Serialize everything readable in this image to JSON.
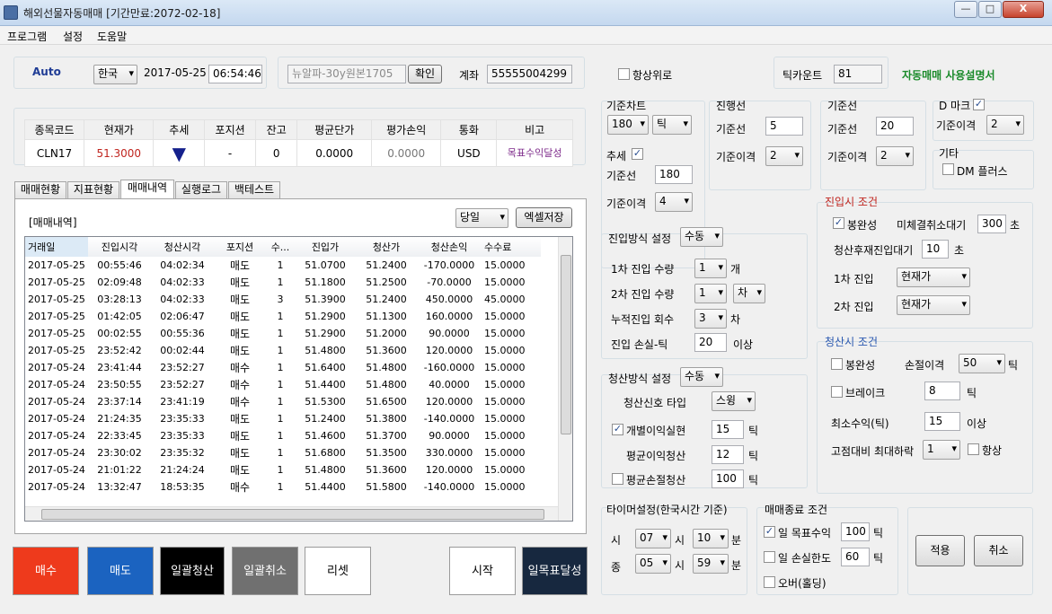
{
  "window": {
    "title": "해외선물자동매매 [기간만료:2072-02-18]",
    "minimize": "—",
    "maximize": "□",
    "close": "X"
  },
  "menu": [
    "프로그램",
    "설정",
    "도움말"
  ],
  "top": {
    "mode": "Auto",
    "country": "한국",
    "date": "2017-05-25",
    "time": "06:54:46",
    "product_placeholder": "뉴알파-30y원본1705",
    "confirm": "확인",
    "account_label": "계좌",
    "account": "55555004299",
    "always_on_top": "항상위로",
    "tick_count_label": "틱카운트",
    "tick_count": "81",
    "manual_link": "자동매매 사용설명서"
  },
  "position": {
    "headers": [
      "종목코드",
      "현재가",
      "추세",
      "포지션",
      "잔고",
      "평균단가",
      "평가손익",
      "통화",
      "비고"
    ],
    "row": {
      "code": "CLN17",
      "price": "51.3000",
      "trend": "▼",
      "position": "-",
      "balance": "0",
      "avg": "0.0000",
      "pnl": "0.0000",
      "currency": "USD",
      "note": "목표수익달성"
    }
  },
  "tabs": [
    "매매현황",
    "지표현황",
    "매매내역",
    "실행로그",
    "백테스트"
  ],
  "history": {
    "title": "[매매내역]",
    "period": "당일",
    "export": "엑셀저장",
    "headers": [
      "거래일",
      "진입시각",
      "청산시각",
      "포지션",
      "수...",
      "진입가",
      "청산가",
      "청산손익",
      "수수료"
    ],
    "rows": [
      [
        "2017-05-25",
        "00:55:46",
        "04:02:34",
        "매도",
        "1",
        "51.0700",
        "51.2400",
        "-170.0000",
        "15.0000"
      ],
      [
        "2017-05-25",
        "02:09:48",
        "04:02:33",
        "매도",
        "1",
        "51.1800",
        "51.2500",
        "-70.0000",
        "15.0000"
      ],
      [
        "2017-05-25",
        "03:28:13",
        "04:02:33",
        "매도",
        "3",
        "51.3900",
        "51.2400",
        "450.0000",
        "45.0000"
      ],
      [
        "2017-05-25",
        "01:42:05",
        "02:06:47",
        "매도",
        "1",
        "51.2900",
        "51.1300",
        "160.0000",
        "15.0000"
      ],
      [
        "2017-05-25",
        "00:02:55",
        "00:55:36",
        "매도",
        "1",
        "51.2900",
        "51.2000",
        "90.0000",
        "15.0000"
      ],
      [
        "2017-05-25",
        "23:52:42",
        "00:02:44",
        "매도",
        "1",
        "51.4800",
        "51.3600",
        "120.0000",
        "15.0000"
      ],
      [
        "2017-05-24",
        "23:41:44",
        "23:52:27",
        "매수",
        "1",
        "51.6400",
        "51.4800",
        "-160.0000",
        "15.0000"
      ],
      [
        "2017-05-24",
        "23:50:55",
        "23:52:27",
        "매수",
        "1",
        "51.4400",
        "51.4800",
        "40.0000",
        "15.0000"
      ],
      [
        "2017-05-24",
        "23:37:14",
        "23:41:19",
        "매수",
        "1",
        "51.5300",
        "51.6500",
        "120.0000",
        "15.0000"
      ],
      [
        "2017-05-24",
        "21:24:35",
        "23:35:33",
        "매도",
        "1",
        "51.2400",
        "51.3800",
        "-140.0000",
        "15.0000"
      ],
      [
        "2017-05-24",
        "22:33:45",
        "23:35:33",
        "매도",
        "1",
        "51.4600",
        "51.3700",
        "90.0000",
        "15.0000"
      ],
      [
        "2017-05-24",
        "23:30:02",
        "23:35:32",
        "매도",
        "1",
        "51.6800",
        "51.3500",
        "330.0000",
        "15.0000"
      ],
      [
        "2017-05-24",
        "21:01:22",
        "21:24:24",
        "매도",
        "1",
        "51.4800",
        "51.3600",
        "120.0000",
        "15.0000"
      ],
      [
        "2017-05-24",
        "13:32:47",
        "18:53:35",
        "매수",
        "1",
        "51.4400",
        "51.5800",
        "-140.0000",
        "15.0000"
      ]
    ]
  },
  "buttons": {
    "buy": "매수",
    "sell": "매도",
    "liquidate_all": "일괄청산",
    "cancel_all": "일괄취소",
    "reset": "리셋",
    "start": "시작",
    "daily_target": "일목표달성"
  },
  "chart_base": {
    "title": "기준차트",
    "value": "180",
    "unit": "틱",
    "trend_label": "추세",
    "trend_base_label": "기준선",
    "trend_base": "180",
    "trend_dev_label": "기준이격",
    "trend_dev": "4"
  },
  "progress_line": {
    "title": "진행선",
    "base_label": "기준선",
    "base": "5",
    "dev_label": "기준이격",
    "dev": "2"
  },
  "base_line": {
    "title": "기준선",
    "base_label": "기준선",
    "base": "20",
    "dev_label": "기준이격",
    "dev": "2"
  },
  "d_mark": {
    "title": "D 마크",
    "dev_label": "기준이격",
    "dev": "2"
  },
  "other": {
    "title": "기타",
    "dm_plus": "DM 플러스"
  },
  "entry_method": {
    "label": "진입방식 설정",
    "value": "수동",
    "q1_label": "1차 진입 수량",
    "q1": "1",
    "q1_unit": "개",
    "q2_label": "2차 진입 수량",
    "q2": "1",
    "q2_unit": "차",
    "cum_label": "누적진입 회수",
    "cum": "3",
    "cum_unit": "차",
    "loss_label": "진입 손실-틱",
    "loss": "20",
    "loss_unit": "이상"
  },
  "exit_method": {
    "label": "청산방식 설정",
    "value": "수동",
    "signal_label": "청산신호 타입",
    "signal": "스윙",
    "indiv_label": "개별이익실현",
    "indiv": "15",
    "avg_profit_label": "평균이익청산",
    "avg_profit": "12",
    "avg_loss_label": "평균손절청산",
    "avg_loss": "100",
    "unit": "틱"
  },
  "entry_cond": {
    "title": "진입시 조건",
    "bongwan": "봉완성",
    "unfilled_label": "미체결취소대기",
    "unfilled": "300",
    "sec": "초",
    "reentry_label": "청산후재진입대기",
    "reentry": "10",
    "e1_label": "1차 진입",
    "e1": "현재가",
    "e2_label": "2차 진입",
    "e2": "현재가"
  },
  "exit_cond": {
    "title": "청산시 조건",
    "bongwan": "봉완성",
    "stop_label": "손절이격",
    "stop": "50",
    "brake": "브레이크",
    "brake_val": "8",
    "min_profit_label": "최소수익(틱)",
    "min_profit": "15",
    "min_unit": "이상",
    "drop_label": "고점대비 최대하락",
    "drop": "1",
    "always": "항상",
    "tick": "틱"
  },
  "timer": {
    "title": "타이머설정(한국시간 기준)",
    "start_label": "시",
    "start_h": "07",
    "start_h_unit": "시",
    "start_m": "10",
    "start_m_unit": "분",
    "end_label": "종",
    "end_h": "05",
    "end_h_unit": "시",
    "end_m": "59",
    "end_m_unit": "분"
  },
  "trade_end": {
    "title": "매매종료 조건",
    "daily_target_label": "일 목표수익",
    "daily_target": "100",
    "daily_loss_label": "일 손실한도",
    "daily_loss": "60",
    "overnight": "오버(홀딩)",
    "tick": "틱"
  },
  "actions": {
    "apply": "적용",
    "cancel": "취소"
  }
}
